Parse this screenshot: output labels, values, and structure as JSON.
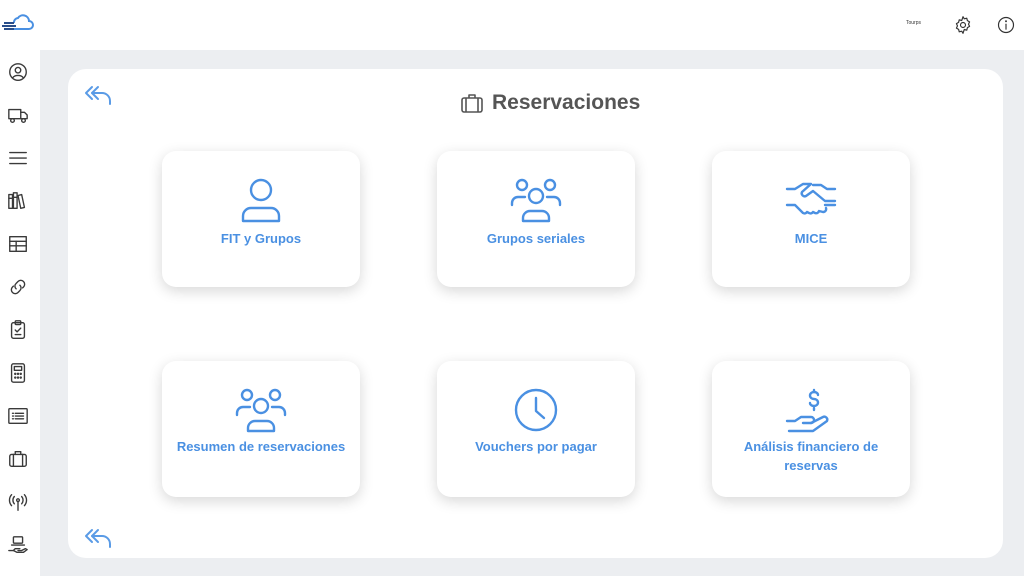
{
  "topbar": {
    "brand_text": "Tourps",
    "settings_icon": "gear-icon",
    "info_icon": "info-icon"
  },
  "sidebar": {
    "logo_icon": "cloud-logo-icon",
    "items": [
      {
        "icon": "user-circle-icon"
      },
      {
        "icon": "truck-icon"
      },
      {
        "icon": "menu-lines-icon"
      },
      {
        "icon": "books-icon"
      },
      {
        "icon": "table-icon"
      },
      {
        "icon": "link-icon"
      },
      {
        "icon": "clipboard-icon"
      },
      {
        "icon": "calculator-icon"
      },
      {
        "icon": "list-icon"
      },
      {
        "icon": "briefcase-icon"
      },
      {
        "icon": "antenna-icon"
      },
      {
        "icon": "hand-laptop-icon"
      }
    ]
  },
  "main": {
    "title": "Reservaciones",
    "title_icon": "briefcase-icon",
    "back_icon": "double-back-arrow-icon",
    "cards": [
      {
        "label": "FIT y Grupos",
        "icon": "single-user-icon"
      },
      {
        "label": "Grupos seriales",
        "icon": "group-users-icon"
      },
      {
        "label": "MICE",
        "icon": "handshake-icon"
      },
      {
        "label": "Resumen de reservaciones",
        "icon": "group-users-icon"
      },
      {
        "label": "Vouchers por pagar",
        "icon": "clock-icon"
      },
      {
        "label": "Análisis financiero de reservas",
        "icon": "hand-dollar-icon"
      }
    ]
  },
  "colors": {
    "accent": "#4a90e2",
    "background": "#eceef1",
    "panel": "#ffffff"
  }
}
